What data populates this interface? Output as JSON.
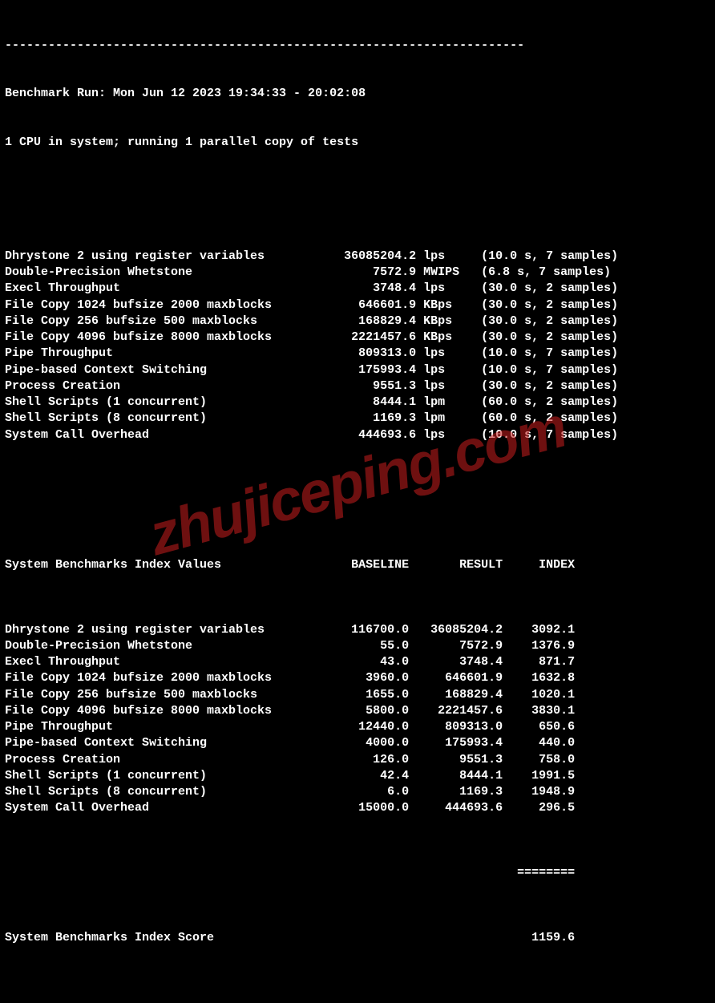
{
  "header": {
    "dashes": "------------------------------------------------------------------------",
    "run_line": "Benchmark Run: Mon Jun 12 2023 19:34:33 - 20:02:08",
    "cpu_line": "1 CPU in system; running 1 parallel copy of tests"
  },
  "results": [
    {
      "name": "Dhrystone 2 using register variables",
      "value": "36085204.2",
      "unit": "lps",
      "meta": "(10.0 s, 7 samples)"
    },
    {
      "name": "Double-Precision Whetstone",
      "value": "7572.9",
      "unit": "MWIPS",
      "meta": "(6.8 s, 7 samples)"
    },
    {
      "name": "Execl Throughput",
      "value": "3748.4",
      "unit": "lps",
      "meta": "(30.0 s, 2 samples)"
    },
    {
      "name": "File Copy 1024 bufsize 2000 maxblocks",
      "value": "646601.9",
      "unit": "KBps",
      "meta": "(30.0 s, 2 samples)"
    },
    {
      "name": "File Copy 256 bufsize 500 maxblocks",
      "value": "168829.4",
      "unit": "KBps",
      "meta": "(30.0 s, 2 samples)"
    },
    {
      "name": "File Copy 4096 bufsize 8000 maxblocks",
      "value": "2221457.6",
      "unit": "KBps",
      "meta": "(30.0 s, 2 samples)"
    },
    {
      "name": "Pipe Throughput",
      "value": "809313.0",
      "unit": "lps",
      "meta": "(10.0 s, 7 samples)"
    },
    {
      "name": "Pipe-based Context Switching",
      "value": "175993.4",
      "unit": "lps",
      "meta": "(10.0 s, 7 samples)"
    },
    {
      "name": "Process Creation",
      "value": "9551.3",
      "unit": "lps",
      "meta": "(30.0 s, 2 samples)"
    },
    {
      "name": "Shell Scripts (1 concurrent)",
      "value": "8444.1",
      "unit": "lpm",
      "meta": "(60.0 s, 2 samples)"
    },
    {
      "name": "Shell Scripts (8 concurrent)",
      "value": "1169.3",
      "unit": "lpm",
      "meta": "(60.0 s, 2 samples)"
    },
    {
      "name": "System Call Overhead",
      "value": "444693.6",
      "unit": "lps",
      "meta": "(10.0 s, 7 samples)"
    }
  ],
  "index_header": {
    "title": "System Benchmarks Index Values",
    "baseline": "BASELINE",
    "result": "RESULT",
    "index": "INDEX"
  },
  "index": [
    {
      "name": "Dhrystone 2 using register variables",
      "baseline": "116700.0",
      "result": "36085204.2",
      "index": "3092.1"
    },
    {
      "name": "Double-Precision Whetstone",
      "baseline": "55.0",
      "result": "7572.9",
      "index": "1376.9"
    },
    {
      "name": "Execl Throughput",
      "baseline": "43.0",
      "result": "3748.4",
      "index": "871.7"
    },
    {
      "name": "File Copy 1024 bufsize 2000 maxblocks",
      "baseline": "3960.0",
      "result": "646601.9",
      "index": "1632.8"
    },
    {
      "name": "File Copy 256 bufsize 500 maxblocks",
      "baseline": "1655.0",
      "result": "168829.4",
      "index": "1020.1"
    },
    {
      "name": "File Copy 4096 bufsize 8000 maxblocks",
      "baseline": "5800.0",
      "result": "2221457.6",
      "index": "3830.1"
    },
    {
      "name": "Pipe Throughput",
      "baseline": "12440.0",
      "result": "809313.0",
      "index": "650.6"
    },
    {
      "name": "Pipe-based Context Switching",
      "baseline": "4000.0",
      "result": "175993.4",
      "index": "440.0"
    },
    {
      "name": "Process Creation",
      "baseline": "126.0",
      "result": "9551.3",
      "index": "758.0"
    },
    {
      "name": "Shell Scripts (1 concurrent)",
      "baseline": "42.4",
      "result": "8444.1",
      "index": "1991.5"
    },
    {
      "name": "Shell Scripts (8 concurrent)",
      "baseline": "6.0",
      "result": "1169.3",
      "index": "1948.9"
    },
    {
      "name": "System Call Overhead",
      "baseline": "15000.0",
      "result": "444693.6",
      "index": "296.5"
    }
  ],
  "score": {
    "separator": "========",
    "label": "System Benchmarks Index Score",
    "value": "1159.6"
  },
  "watermark": "zhujiceping.com"
}
